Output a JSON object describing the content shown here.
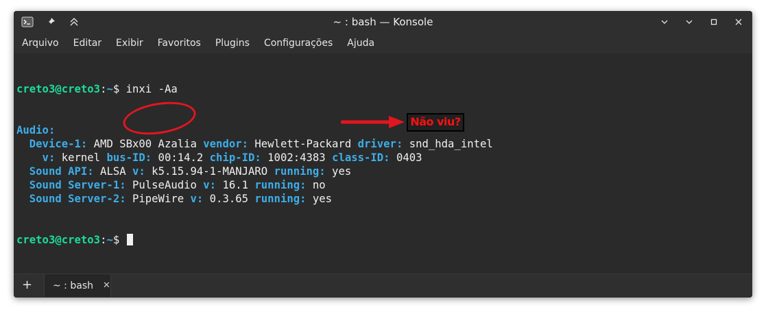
{
  "window": {
    "title": "~ : bash — Konsole",
    "icons": [
      "terminal-app-icon",
      "pin-icon",
      "keep-above-icon"
    ],
    "controls": [
      "chevron-down-icon",
      "minimize-icon",
      "maximize-icon",
      "close-icon"
    ]
  },
  "menubar": {
    "items": [
      "Arquivo",
      "Editar",
      "Exibir",
      "Favoritos",
      "Plugins",
      "Configurações",
      "Ajuda"
    ]
  },
  "terminal": {
    "prompt_user": "creto3@creto3",
    "prompt_sep": ":",
    "prompt_dir": "~",
    "prompt_symbol": "$",
    "command": " inxi -Aa",
    "lines": [
      [
        {
          "t": "Audio:",
          "c": "key"
        }
      ],
      [
        {
          "t": "  Device-1:",
          "c": "key"
        },
        {
          "t": " AMD SBx00 Azalia ",
          "c": "val"
        },
        {
          "t": "vendor:",
          "c": "key"
        },
        {
          "t": " Hewlett-Packard ",
          "c": "val"
        },
        {
          "t": "driver:",
          "c": "key"
        },
        {
          "t": " snd_hda_intel",
          "c": "val"
        }
      ],
      [
        {
          "t": "    v:",
          "c": "key"
        },
        {
          "t": " kernel ",
          "c": "val"
        },
        {
          "t": "bus-ID:",
          "c": "key"
        },
        {
          "t": " 00:14.2 ",
          "c": "val"
        },
        {
          "t": "chip-ID:",
          "c": "key"
        },
        {
          "t": " 1002:4383 ",
          "c": "val"
        },
        {
          "t": "class-ID:",
          "c": "key"
        },
        {
          "t": " 0403",
          "c": "val"
        }
      ],
      [
        {
          "t": "  Sound API:",
          "c": "key"
        },
        {
          "t": " ALSA ",
          "c": "val"
        },
        {
          "t": "v:",
          "c": "key"
        },
        {
          "t": " k5.15.94-1-MANJARO ",
          "c": "val"
        },
        {
          "t": "running:",
          "c": "key"
        },
        {
          "t": " yes",
          "c": "val"
        }
      ],
      [
        {
          "t": "  Sound Server-1:",
          "c": "key"
        },
        {
          "t": " PulseAudio ",
          "c": "val"
        },
        {
          "t": "v:",
          "c": "key"
        },
        {
          "t": " 16.1 ",
          "c": "val"
        },
        {
          "t": "running:",
          "c": "key"
        },
        {
          "t": " no",
          "c": "val"
        }
      ],
      [
        {
          "t": "  Sound Server-2:",
          "c": "key"
        },
        {
          "t": " PipeWire ",
          "c": "val"
        },
        {
          "t": "v:",
          "c": "key"
        },
        {
          "t": " 0.3.65 ",
          "c": "val"
        },
        {
          "t": "running:",
          "c": "key"
        },
        {
          "t": " yes",
          "c": "val"
        }
      ]
    ]
  },
  "annotation": {
    "callout_text": "Não viu?",
    "color": "#e3161f"
  },
  "tabbar": {
    "new_tab": "+",
    "tab_label": "~ : bash",
    "tab_close": "✕"
  },
  "colors": {
    "prompt": "#1cdc9a",
    "key": "#3daee9",
    "text": "#f0f0f0",
    "background": "#2a2a2a"
  }
}
